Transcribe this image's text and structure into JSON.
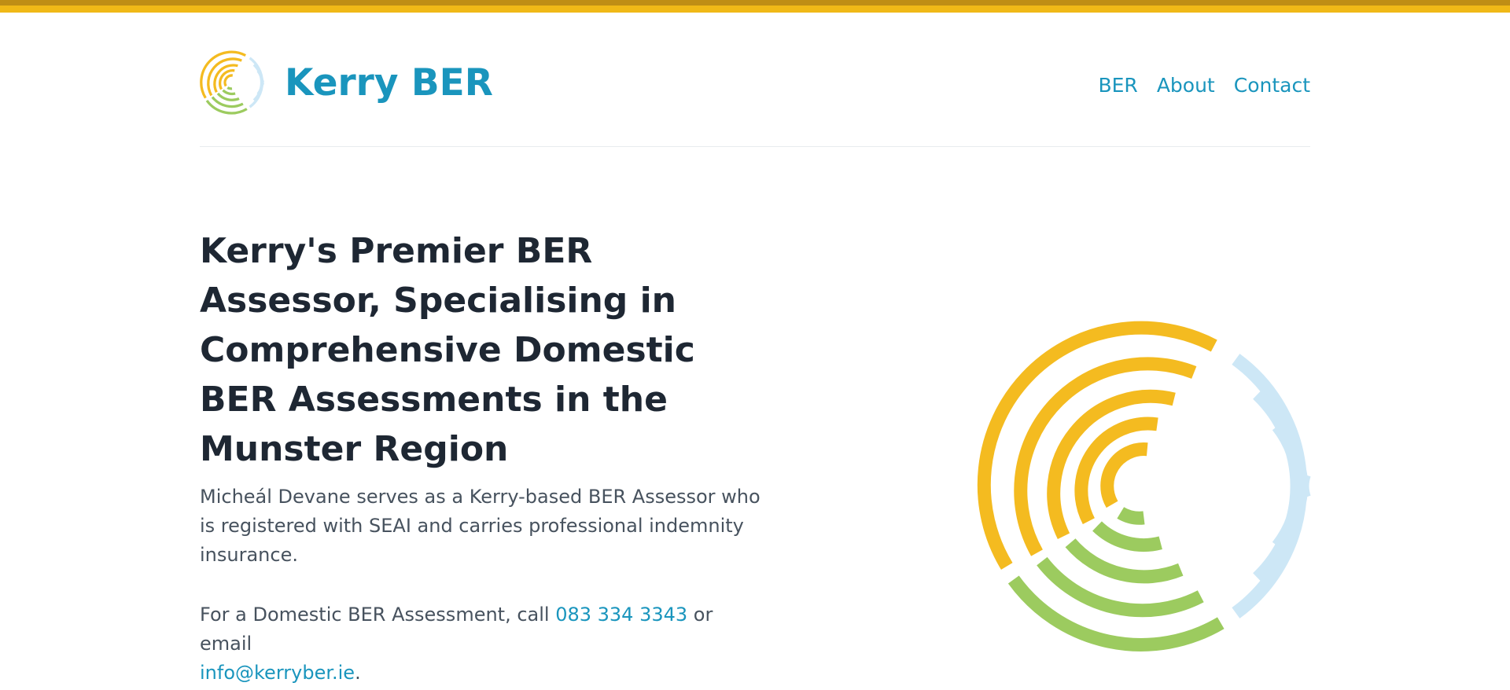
{
  "colors": {
    "accent_yellow": "#f0b917",
    "brand_blue": "#1a95bd",
    "logo_green": "#9ccb5f",
    "logo_light_blue": "#cce7f5",
    "heading": "#1e2733"
  },
  "header": {
    "brand_name": "Kerry BER",
    "logo_icon": "concentric-arcs-logo",
    "nav": [
      {
        "label": "BER"
      },
      {
        "label": "About"
      },
      {
        "label": "Contact"
      }
    ]
  },
  "hero": {
    "title": "Kerry's Premier BER Assessor, Specialising in Comprehensive Domestic BER Assessments in the Munster Region",
    "intro": "Micheál Devane serves as a Kerry-based BER Assessor who is registered with SEAI and carries professional indemnity insurance.",
    "cta_prefix": "For a Domestic BER Assessment, call ",
    "phone": "083 334 3343",
    "cta_middle": " or email",
    "email": "info@kerryber.ie",
    "cta_suffix": "."
  }
}
